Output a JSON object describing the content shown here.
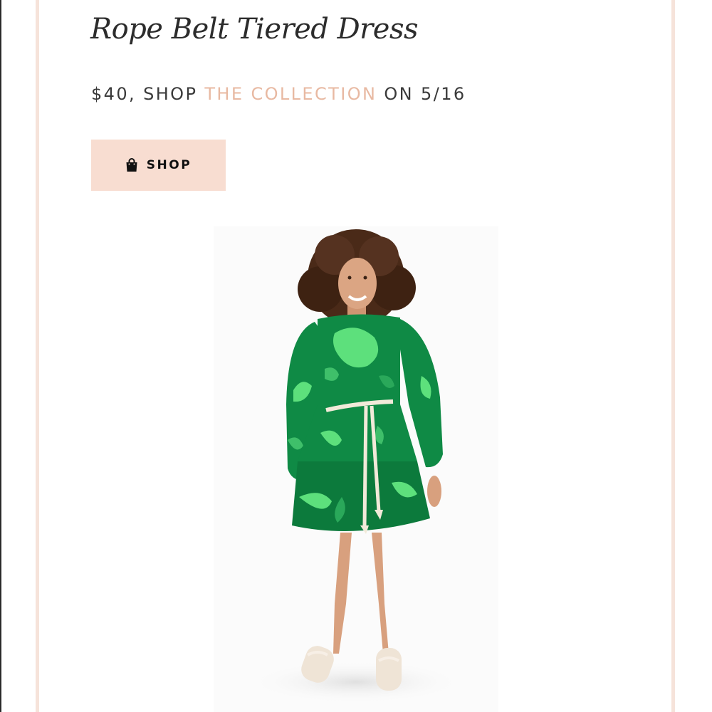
{
  "product": {
    "title": "Rope Belt Tiered Dress",
    "price_prefix": "$40, SHOP ",
    "collection_link": "THE COLLECTION",
    "price_suffix": " ON 5/16"
  },
  "shop_button": {
    "label": "SHOP",
    "icon": "shopping-bag-icon"
  },
  "image": {
    "alt": "Model wearing green tie-dye rope belt tiered dress"
  },
  "colors": {
    "accent_link": "#e8b9a2",
    "button_bg": "#f8ddd1",
    "card_border": "#f6e3da",
    "dress_green_dark": "#0f8a45",
    "dress_green_light": "#5de07c"
  }
}
